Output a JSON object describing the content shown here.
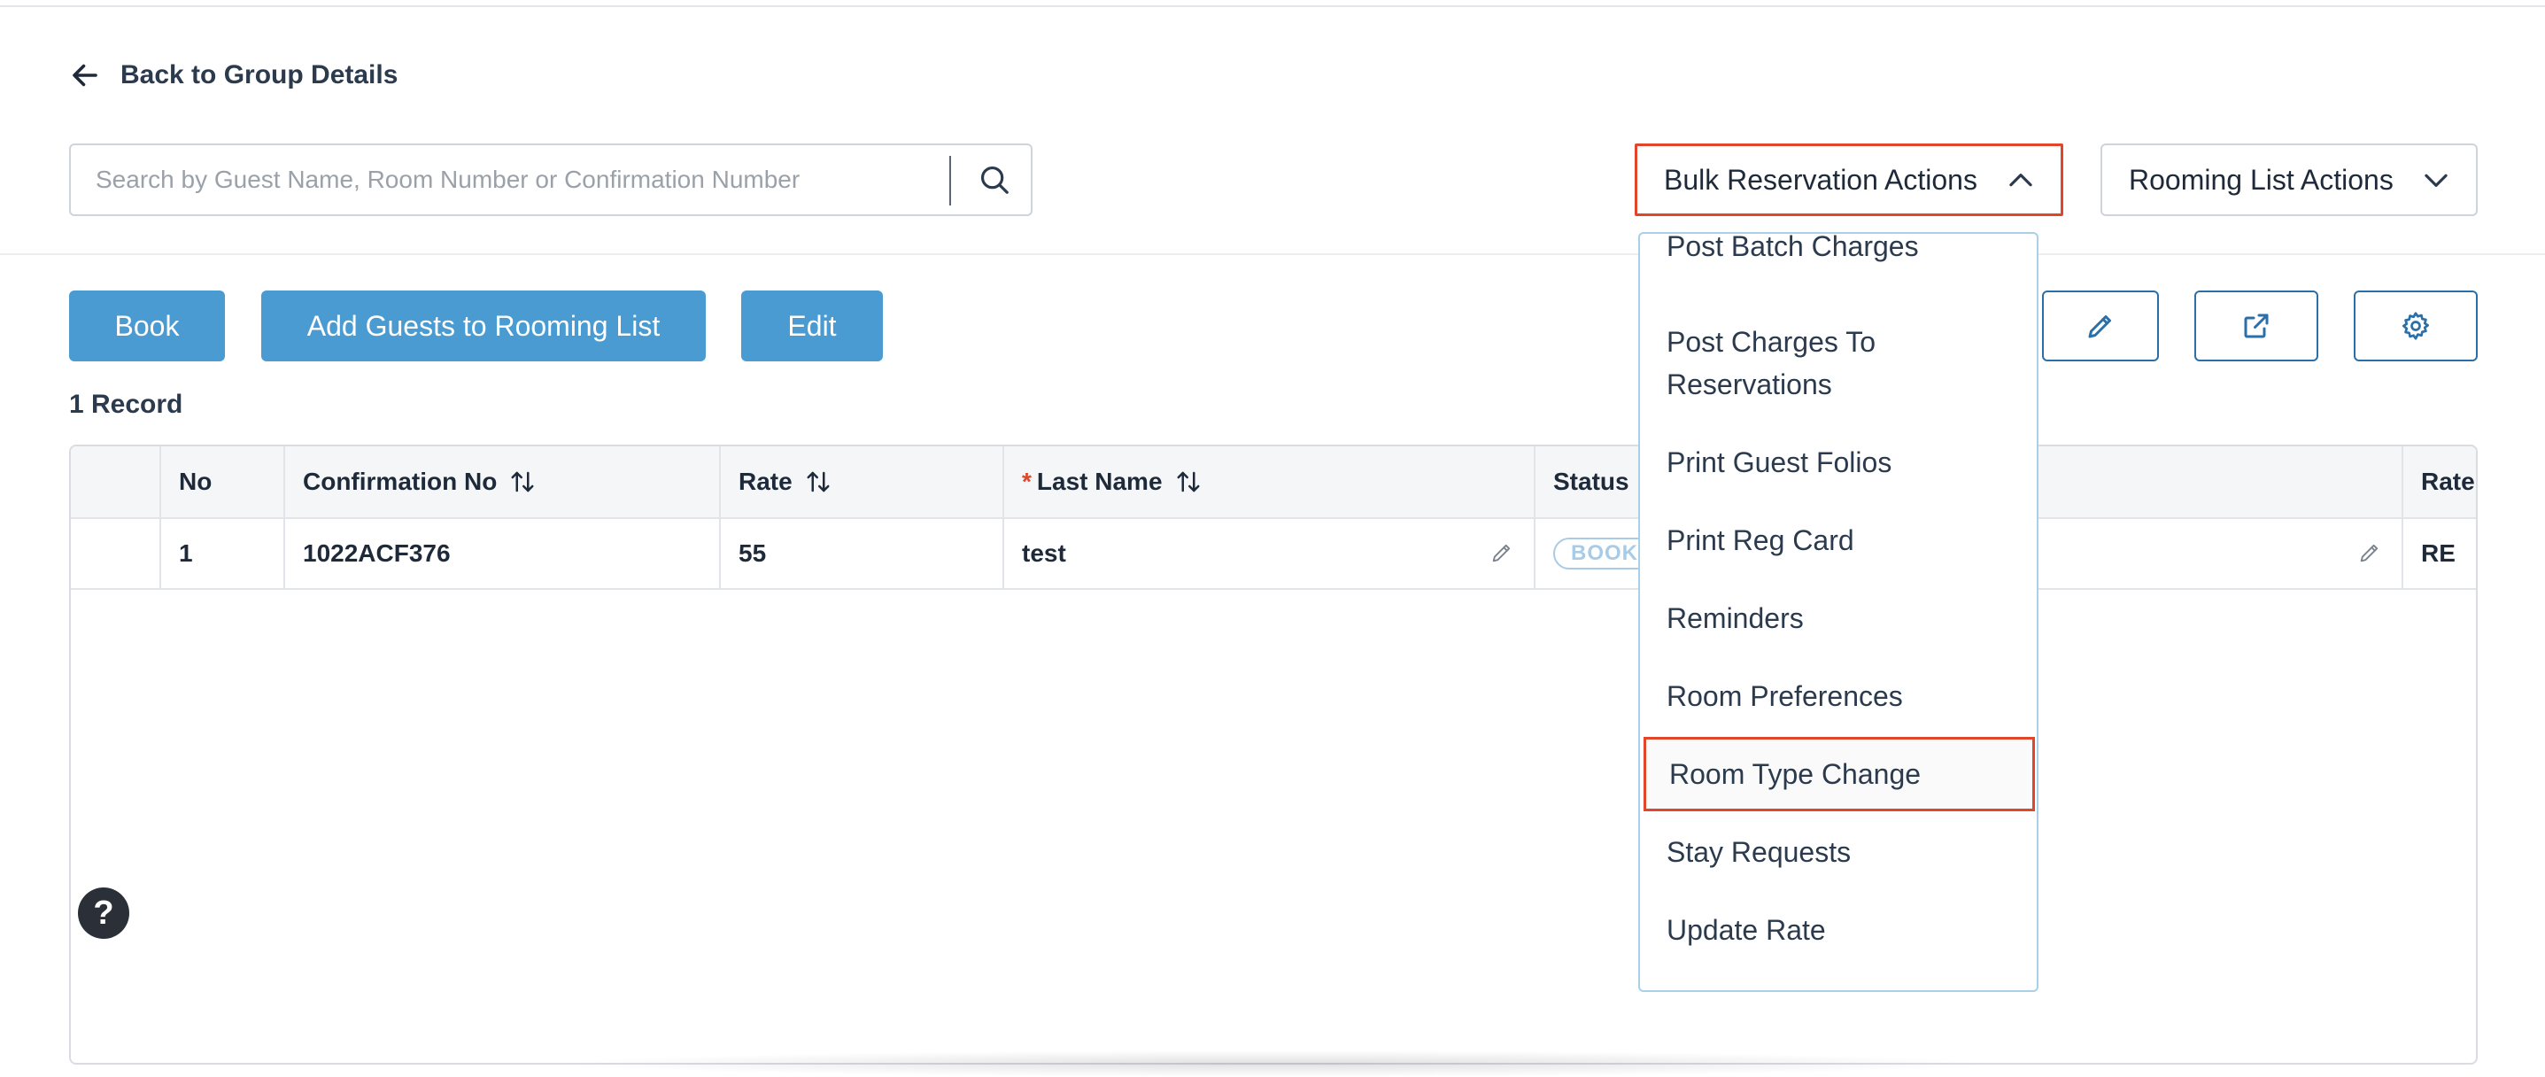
{
  "back_link": {
    "label": "Back to Group Details",
    "icon": "arrow-left-icon"
  },
  "search": {
    "placeholder": "Search by Guest Name, Room Number or Confirmation Number",
    "value": "",
    "icon": "search-icon"
  },
  "actions": {
    "bulk_label": "Bulk Reservation Actions",
    "rooming_label": "Rooming List Actions"
  },
  "buttons": {
    "book": "Book",
    "add_guests": "Add Guests to Rooming List",
    "edit": "Edit"
  },
  "icon_buttons": [
    "pencil-icon",
    "external-link-icon",
    "gear-icon"
  ],
  "record_count": "1 Record",
  "table": {
    "columns": [
      "No",
      "Confirmation No",
      "Rate",
      "Last Name",
      "Status",
      "",
      "Rate"
    ],
    "required_marker": "*",
    "rows": [
      {
        "no": "1",
        "confirmation": "1022ACF376",
        "rate": "55",
        "last_name": "test",
        "status": "BOOKED",
        "rate_code": "RE"
      }
    ]
  },
  "bulk_menu": {
    "items": [
      "Post Batch Charges",
      "Post Charges To",
      "Reservations",
      "Print Guest Folios",
      "Print Reg Card",
      "Reminders",
      "Room Preferences",
      "Room Type Change",
      "Stay Requests",
      "Update Rate"
    ],
    "highlighted": "Room Type Change"
  },
  "help": {
    "label": "?"
  },
  "colors": {
    "primary": "#4a9bd1",
    "highlight": "#e1452a",
    "icon_border": "#2a6fa8"
  }
}
